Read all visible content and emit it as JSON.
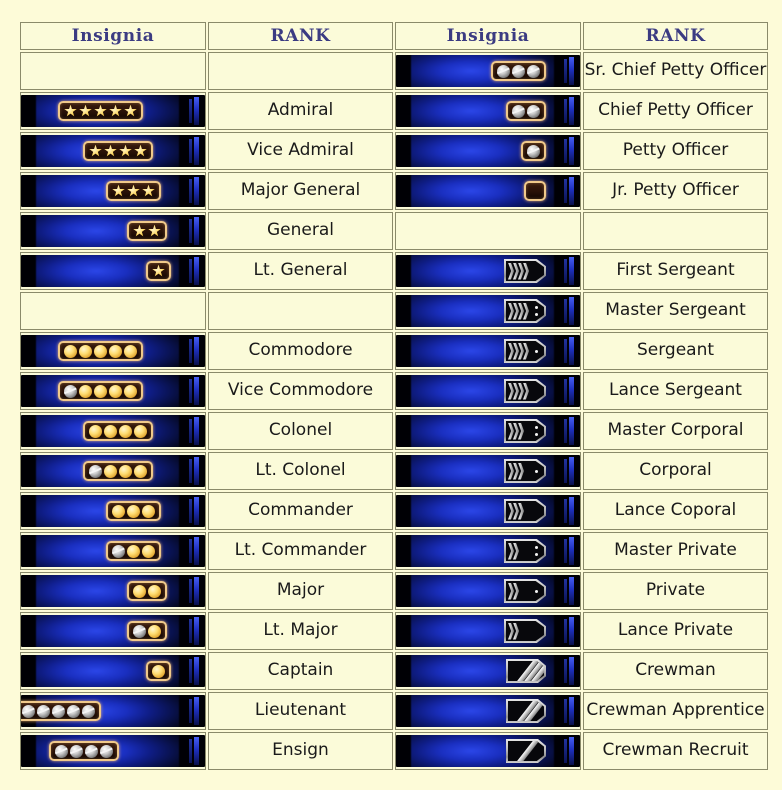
{
  "page": {
    "background_color": "#fdfbd8",
    "table_border_color": "#8a8a6a",
    "cell_background": "#fbfbd9",
    "blank_cell_color": "#b2b2b2",
    "header_text_color": "#3b3b82"
  },
  "headers": {
    "insignia_left": "Insignia",
    "rank_left": "RANK",
    "insignia_right": "Insignia",
    "rank_right": "RANK"
  },
  "rows": [
    {
      "left": {
        "blank": true
      },
      "right": {
        "blank": false,
        "rank": "Sr. Chief Petty Officer",
        "insignia": {
          "kind": "plaque",
          "offset": 34,
          "items": [
            "silver",
            "silver",
            "silver"
          ]
        }
      }
    },
    {
      "left": {
        "blank": false,
        "rank": "Admiral",
        "insignia": {
          "kind": "plaque",
          "offset": 62,
          "items": [
            "star",
            "star",
            "star",
            "star",
            "star"
          ]
        }
      },
      "right": {
        "blank": false,
        "rank": "Chief Petty Officer",
        "insignia": {
          "kind": "plaque",
          "offset": 34,
          "items": [
            "silver",
            "silver"
          ]
        }
      }
    },
    {
      "left": {
        "blank": false,
        "rank": "Vice Admiral",
        "insignia": {
          "kind": "plaque",
          "offset": 52,
          "items": [
            "star",
            "star",
            "star",
            "star"
          ]
        }
      },
      "right": {
        "blank": false,
        "rank": "Petty Officer",
        "insignia": {
          "kind": "plaque",
          "offset": 34,
          "items": [
            "silver"
          ]
        }
      }
    },
    {
      "left": {
        "blank": false,
        "rank": "Major General",
        "insignia": {
          "kind": "plaque",
          "offset": 44,
          "items": [
            "star",
            "star",
            "star"
          ]
        }
      },
      "right": {
        "blank": false,
        "rank": "Jr. Petty Officer",
        "insignia": {
          "kind": "plaque",
          "offset": 34,
          "items": []
        }
      }
    },
    {
      "left": {
        "blank": false,
        "rank": "General",
        "insignia": {
          "kind": "plaque",
          "offset": 38,
          "items": [
            "star",
            "star"
          ]
        }
      },
      "right": {
        "blank": true
      }
    },
    {
      "left": {
        "blank": false,
        "rank": "Lt. General",
        "insignia": {
          "kind": "plaque",
          "offset": 34,
          "items": [
            "star"
          ]
        }
      },
      "right": {
        "blank": false,
        "rank": "First Sergeant",
        "insignia": {
          "kind": "chevron",
          "offset": 34,
          "chevrons": 4,
          "dots": 0
        }
      }
    },
    {
      "left": {
        "blank": true
      },
      "right": {
        "blank": false,
        "rank": "Master Sergeant",
        "insignia": {
          "kind": "chevron",
          "offset": 34,
          "chevrons": 4,
          "dots": 2
        }
      }
    },
    {
      "left": {
        "blank": false,
        "rank": "Commodore",
        "insignia": {
          "kind": "plaque",
          "offset": 62,
          "items": [
            "gold",
            "gold",
            "gold",
            "gold",
            "gold"
          ]
        }
      },
      "right": {
        "blank": false,
        "rank": "Sergeant",
        "insignia": {
          "kind": "chevron",
          "offset": 34,
          "chevrons": 4,
          "dots": 1
        }
      }
    },
    {
      "left": {
        "blank": false,
        "rank": "Vice Commodore",
        "insignia": {
          "kind": "plaque",
          "offset": 62,
          "items": [
            "silver",
            "gold",
            "gold",
            "gold",
            "gold"
          ]
        }
      },
      "right": {
        "blank": false,
        "rank": "Lance Sergeant",
        "insignia": {
          "kind": "chevron",
          "offset": 34,
          "chevrons": 4,
          "dots": 0
        }
      }
    },
    {
      "left": {
        "blank": false,
        "rank": "Colonel",
        "insignia": {
          "kind": "plaque",
          "offset": 52,
          "items": [
            "gold",
            "gold",
            "gold",
            "gold"
          ]
        }
      },
      "right": {
        "blank": false,
        "rank": "Master Corporal",
        "insignia": {
          "kind": "chevron",
          "offset": 34,
          "chevrons": 3,
          "dots": 2
        }
      }
    },
    {
      "left": {
        "blank": false,
        "rank": "Lt. Colonel",
        "insignia": {
          "kind": "plaque",
          "offset": 52,
          "items": [
            "silver",
            "gold",
            "gold",
            "gold"
          ]
        }
      },
      "right": {
        "blank": false,
        "rank": "Corporal",
        "insignia": {
          "kind": "chevron",
          "offset": 34,
          "chevrons": 3,
          "dots": 1
        }
      }
    },
    {
      "left": {
        "blank": false,
        "rank": "Commander",
        "insignia": {
          "kind": "plaque",
          "offset": 44,
          "items": [
            "gold",
            "gold",
            "gold"
          ]
        }
      },
      "right": {
        "blank": false,
        "rank": "Lance Coporal",
        "insignia": {
          "kind": "chevron",
          "offset": 34,
          "chevrons": 3,
          "dots": 0
        }
      }
    },
    {
      "left": {
        "blank": false,
        "rank": "Lt. Commander",
        "insignia": {
          "kind": "plaque",
          "offset": 44,
          "items": [
            "silver",
            "gold",
            "gold"
          ]
        }
      },
      "right": {
        "blank": false,
        "rank": "Master Private",
        "insignia": {
          "kind": "chevron",
          "offset": 34,
          "chevrons": 2,
          "dots": 2
        }
      }
    },
    {
      "left": {
        "blank": false,
        "rank": "Major",
        "insignia": {
          "kind": "plaque",
          "offset": 38,
          "items": [
            "gold",
            "gold"
          ]
        }
      },
      "right": {
        "blank": false,
        "rank": "Private",
        "insignia": {
          "kind": "chevron",
          "offset": 34,
          "chevrons": 2,
          "dots": 1
        }
      }
    },
    {
      "left": {
        "blank": false,
        "rank": "Lt. Major",
        "insignia": {
          "kind": "plaque",
          "offset": 38,
          "items": [
            "silver",
            "gold"
          ]
        }
      },
      "right": {
        "blank": false,
        "rank": "Lance Private",
        "insignia": {
          "kind": "chevron",
          "offset": 34,
          "chevrons": 2,
          "dots": 0
        }
      }
    },
    {
      "left": {
        "blank": false,
        "rank": "Captain",
        "insignia": {
          "kind": "plaque",
          "offset": 34,
          "items": [
            "gold"
          ]
        }
      },
      "right": {
        "blank": false,
        "rank": "Crewman",
        "insignia": {
          "kind": "slash",
          "offset": 34,
          "slashes": 3
        }
      }
    },
    {
      "left": {
        "blank": false,
        "rank": "Lieutenant",
        "insignia": {
          "kind": "plaque",
          "offset": 104,
          "items": [
            "silver",
            "silver",
            "silver",
            "silver",
            "silver"
          ]
        }
      },
      "right": {
        "blank": false,
        "rank": "Crewman Apprentice",
        "insignia": {
          "kind": "slash",
          "offset": 34,
          "slashes": 2
        }
      }
    },
    {
      "left": {
        "blank": false,
        "rank": "Ensign",
        "insignia": {
          "kind": "plaque",
          "offset": 86,
          "items": [
            "silver",
            "silver",
            "silver",
            "silver"
          ]
        }
      },
      "right": {
        "blank": false,
        "rank": "Crewman Recruit",
        "insignia": {
          "kind": "slash",
          "offset": 34,
          "slashes": 1
        }
      }
    }
  ]
}
